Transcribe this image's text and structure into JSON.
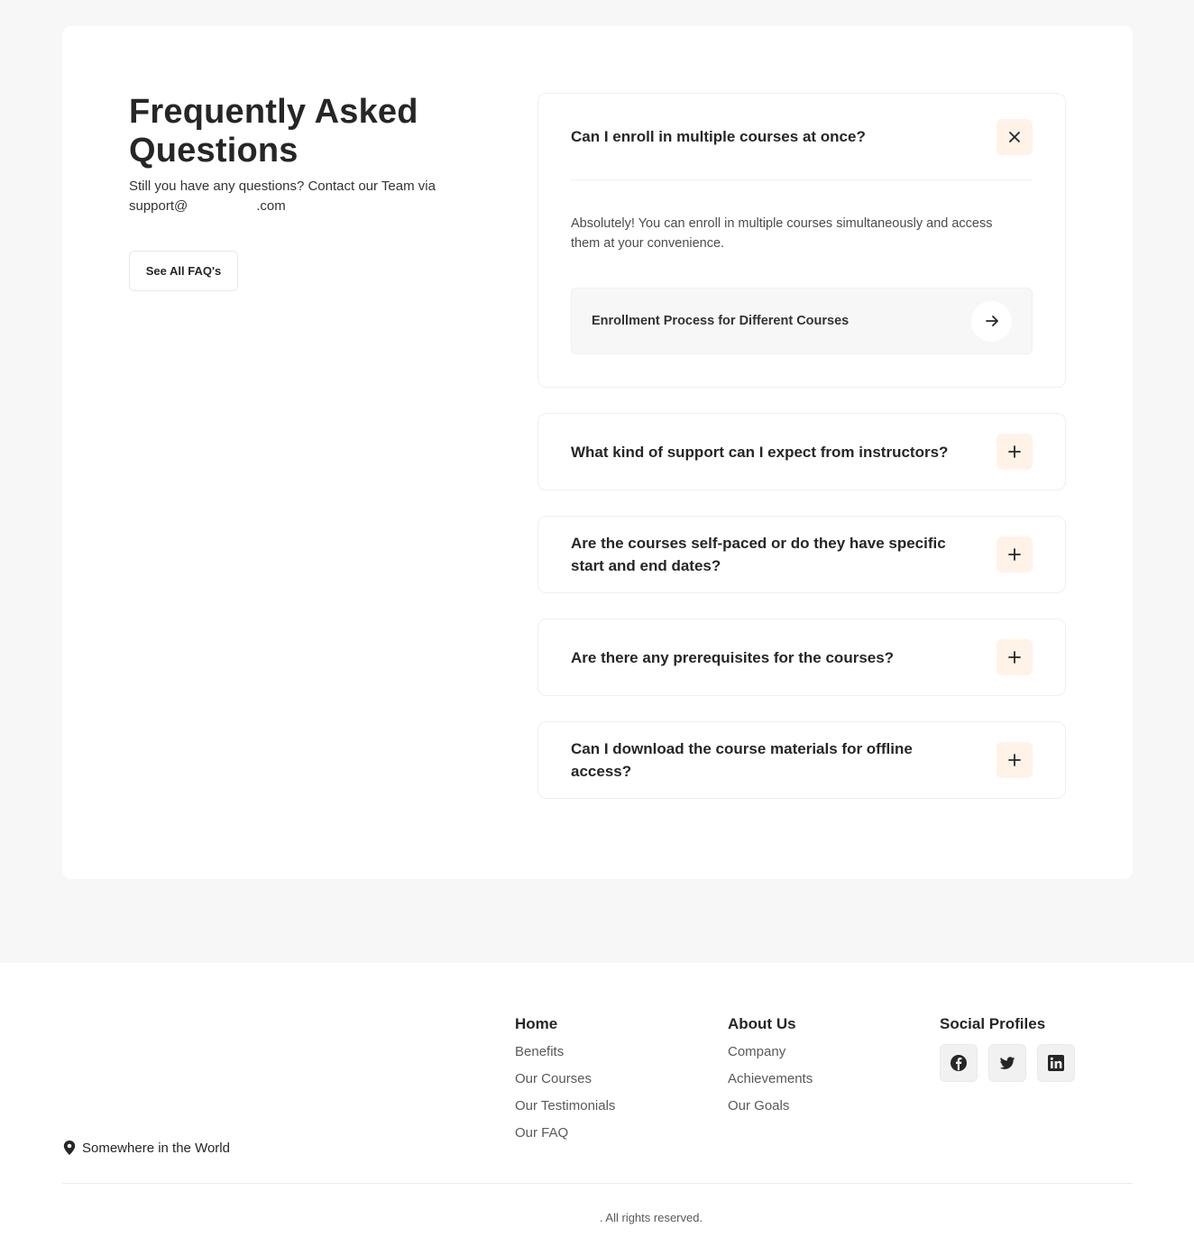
{
  "faq_section": {
    "title": "Frequently Asked Questions",
    "subtitle_prefix": "Still you have any questions? Contact our Team via support@",
    "subtitle_suffix": ".com",
    "see_all_label": "See All FAQ's",
    "accent_color": "#fff3e7",
    "items": [
      {
        "question": "Can I enroll in multiple courses at once?",
        "expanded": true,
        "toggle_icon": "close-icon",
        "answer": "Absolutely! You can enroll in multiple courses simultaneously and access them at your convenience.",
        "related_link": "Enrollment Process for Different Courses",
        "related_icon": "arrow-right-icon"
      },
      {
        "question": "What kind of support can I expect from instructors?",
        "expanded": false,
        "toggle_icon": "plus-icon"
      },
      {
        "question": "Are the courses self-paced or do they have specific start and end dates?",
        "expanded": false,
        "toggle_icon": "plus-icon"
      },
      {
        "question": "Are there any prerequisites for the courses?",
        "expanded": false,
        "toggle_icon": "plus-icon"
      },
      {
        "question": "Can I download the course materials for offline access?",
        "expanded": false,
        "toggle_icon": "plus-icon"
      }
    ]
  },
  "footer": {
    "location": "Somewhere in the World",
    "location_icon": "map-pin-icon",
    "columns": [
      {
        "heading": "Home",
        "links": [
          "Benefits",
          "Our Courses",
          "Our Testimonials",
          "Our FAQ"
        ]
      },
      {
        "heading": "About Us",
        "links": [
          "Company",
          "Achievements",
          "Our Goals"
        ]
      },
      {
        "heading": "Social Profiles",
        "icons": [
          "facebook-icon",
          "twitter-icon",
          "linkedin-icon"
        ]
      }
    ],
    "copyright": ". All rights reserved."
  }
}
